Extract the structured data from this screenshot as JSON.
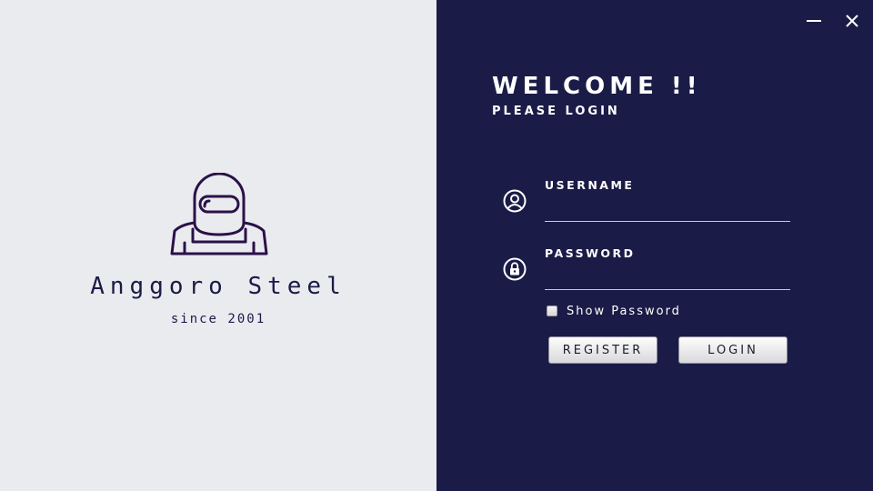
{
  "brand": {
    "name": "Anggoro Steel",
    "tagline": "since 2001",
    "logo_icon": "welder-mask-icon"
  },
  "window": {
    "minimize_icon": "minimize-icon",
    "close_icon": "close-icon"
  },
  "login": {
    "heading": "WELCOME !!",
    "subheading": "PLEASE LOGIN",
    "username_label": "USERNAME",
    "username_value": "",
    "password_label": "PASSWORD",
    "password_value": "",
    "show_password_label": "Show Password",
    "show_password_checked": false,
    "register_label": "REGISTER",
    "login_label": "LOGIN"
  },
  "colors": {
    "left_background": "#eaebef",
    "right_background": "#1b1b47",
    "logo_stroke": "#2a1148"
  }
}
